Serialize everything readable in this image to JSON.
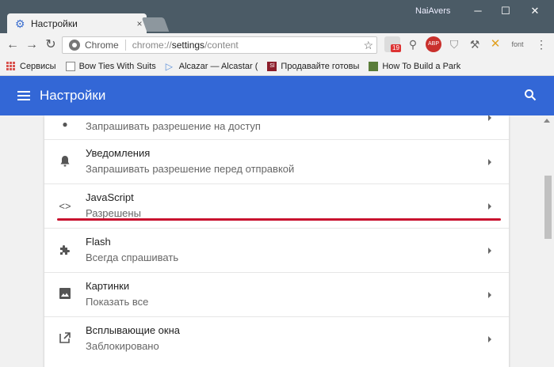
{
  "window": {
    "user_name": "NaiAvers",
    "minimize": "─",
    "maximize": "☐",
    "close": "✕"
  },
  "tab": {
    "title": "Настройки",
    "close": "×"
  },
  "toolbar": {
    "back": "←",
    "forward": "→",
    "reload": "↻",
    "chip": "Chrome",
    "url_scheme": "chrome://",
    "url_host": "settings",
    "url_path": "/content",
    "star": "☆",
    "ext_badge": "19",
    "ext_abp": "ABP",
    "ext_font": "font"
  },
  "bookmarks": [
    {
      "label": "Сервисы",
      "icon": "apps-icon"
    },
    {
      "label": "Bow Ties With Suits",
      "icon": "page-icon"
    },
    {
      "label": "Alcazar — Alcastar (",
      "icon": "play-icon"
    },
    {
      "label": "Продавайте готовы",
      "icon": "sl-icon"
    },
    {
      "label": "How To Build a Park",
      "icon": "block-icon"
    }
  ],
  "header": {
    "title": "Настройки"
  },
  "settings_rows": [
    {
      "title": "",
      "subtitle": "Запрашивать разрешение на доступ",
      "icon": "mic-icon"
    },
    {
      "title": "Уведомления",
      "subtitle": "Запрашивать разрешение перед отправкой",
      "icon": "bell-icon"
    },
    {
      "title": "JavaScript",
      "subtitle": "Разрешены",
      "icon": "code-icon"
    },
    {
      "title": "Flash",
      "subtitle": "Всегда спрашивать",
      "icon": "puzzle-icon"
    },
    {
      "title": "Картинки",
      "subtitle": "Показать все",
      "icon": "image-icon"
    },
    {
      "title": "Всплывающие окна",
      "subtitle": "Заблокировано",
      "icon": "popup-icon"
    }
  ],
  "colors": {
    "header": "#3367d6",
    "highlight": "#c8102e"
  }
}
